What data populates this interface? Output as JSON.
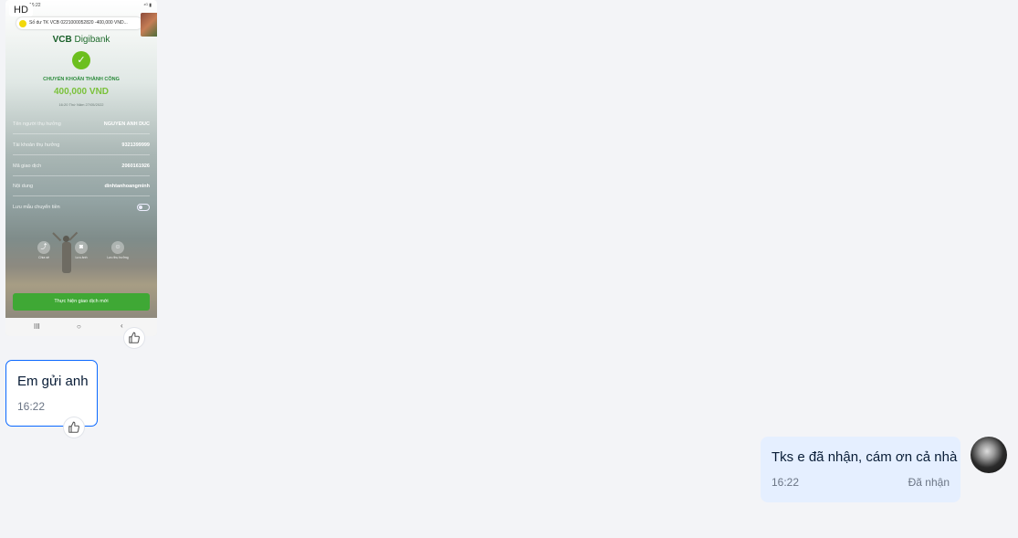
{
  "image_message": {
    "hd_label": "HD",
    "screenshot": {
      "status_time": "16:22",
      "status_icons": "⁴ᴳ ▮",
      "notification": "Số dư TK VCB 0221000052820 -400,000 VND...",
      "logo_bold": "VCB",
      "logo_text": "Digibank",
      "success_title": "CHUYỂN KHOẢN THÀNH CÔNG",
      "amount": "400,000 VND",
      "timestamp": "16:20 Thứ Năm 27/05/2022",
      "details": [
        {
          "label": "Tên người thụ hưởng",
          "value": "NGUYEN ANH DUC"
        },
        {
          "label": "Tài khoản thụ hưởng",
          "value": "9321399999"
        },
        {
          "label": "Mã giao dịch",
          "value": "2060161926"
        },
        {
          "label": "Nội dung",
          "value": "dinhtanhoangminh"
        }
      ],
      "save_template_label": "Lưu mẫu chuyển tiền",
      "actions": [
        {
          "label": "Chia sẻ",
          "icon": "share-icon"
        },
        {
          "label": "Lưu ảnh",
          "icon": "camera-icon"
        },
        {
          "label": "Lưu thụ hưởng",
          "icon": "person-icon"
        }
      ],
      "new_transaction_label": "Thực hiện giao dịch mới",
      "nav_recent": "III",
      "nav_home": "○",
      "nav_back": "‹"
    }
  },
  "messages": [
    {
      "direction": "incoming",
      "text": "Em gửi anh",
      "time": "16:22"
    },
    {
      "direction": "outgoing",
      "text": "Tks e đã nhận, cám ơn cả nhà",
      "time": "16:22",
      "status": "Đã nhận"
    }
  ],
  "colors": {
    "background": "#f3f4f7",
    "incoming_border": "#0a68ff",
    "outgoing_bg": "#e5efff",
    "vcb_green": "#3fa835"
  }
}
